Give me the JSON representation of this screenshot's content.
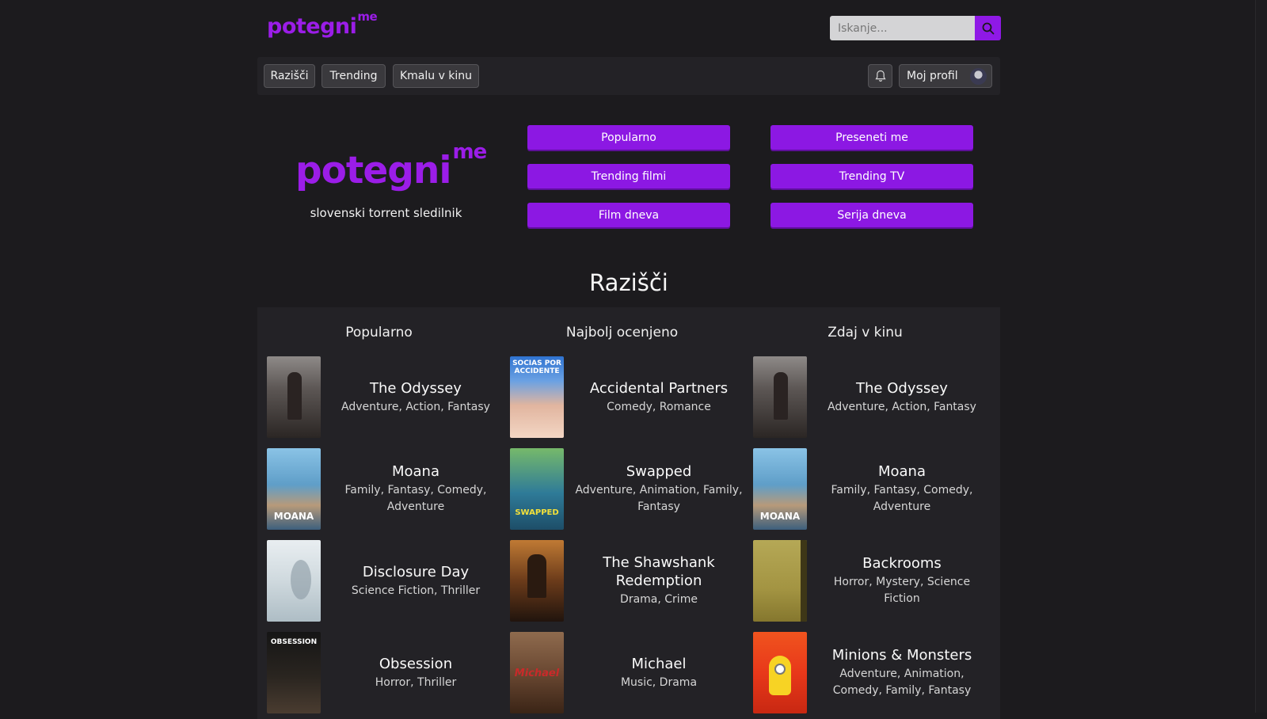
{
  "header": {
    "logo_text": "potegni",
    "logo_sup": "me",
    "search_placeholder": "Iskanje..."
  },
  "nav": {
    "items": [
      "Razišči",
      "Trending",
      "Kmalu v kinu"
    ],
    "profile_label": "Moj profil"
  },
  "hero": {
    "logo_text": "potegni",
    "logo_sup": "me",
    "tagline": "slovenski torrent sledilnik",
    "buttons": [
      "Popularno",
      "Preseneti me",
      "Trending filmi",
      "Trending TV",
      "Film dneva",
      "Serija dneva"
    ]
  },
  "explore": {
    "title": "Razišči",
    "columns": [
      {
        "title": "Popularno",
        "items": [
          {
            "title": "The Odyssey",
            "genres": "Adventure, Action, Fantasy"
          },
          {
            "title": "Moana",
            "genres": "Family, Fantasy, Comedy, Adventure"
          },
          {
            "title": "Disclosure Day",
            "genres": "Science Fiction, Thriller"
          },
          {
            "title": "Obsession",
            "genres": "Horror, Thriller"
          }
        ]
      },
      {
        "title": "Najbolj ocenjeno",
        "items": [
          {
            "title": "Accidental Partners",
            "genres": "Comedy, Romance"
          },
          {
            "title": "Swapped",
            "genres": "Adventure, Animation, Family, Fantasy"
          },
          {
            "title": "The Shawshank Redemption",
            "genres": "Drama, Crime"
          },
          {
            "title": "Michael",
            "genres": "Music, Drama"
          }
        ]
      },
      {
        "title": "Zdaj v kinu",
        "items": [
          {
            "title": "The Odyssey",
            "genres": "Adventure, Action, Fantasy"
          },
          {
            "title": "Moana",
            "genres": "Family, Fantasy, Comedy, Adventure"
          },
          {
            "title": "Backrooms",
            "genres": "Horror, Mystery, Science Fiction"
          },
          {
            "title": "Minions & Monsters",
            "genres": "Adventure, Animation, Comedy, Family, Fantasy"
          }
        ]
      }
    ],
    "poster_texts": {
      "accidental": "SOCIAS POR ACCIDENTE",
      "moana": "MOANA",
      "swapped": "SWAPPED",
      "obsession": "OBSESSION",
      "michael": "Michael"
    }
  },
  "colors": {
    "accent": "#8c18e3",
    "background": "#1c1b1e",
    "panel": "#232226"
  }
}
